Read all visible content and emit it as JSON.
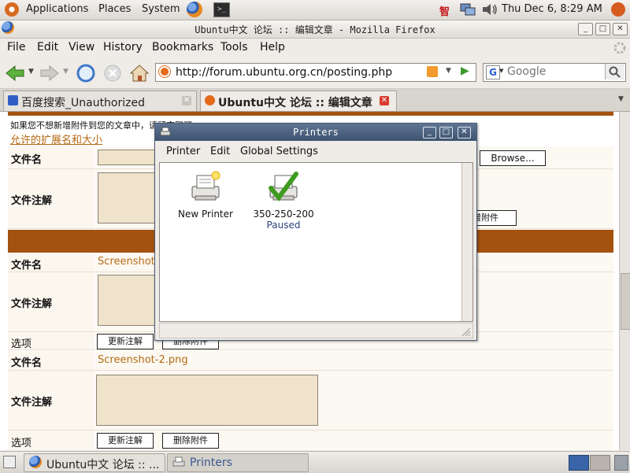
{
  "top_panel": {
    "applications": "Applications",
    "places": "Places",
    "system": "System",
    "ime": "智",
    "clock": "Thu Dec  6,  8:29 AM"
  },
  "firefox": {
    "title": "Ubuntu中文 论坛 :: 编辑文章 - Mozilla Firefox",
    "menu": [
      "File",
      "Edit",
      "View",
      "History",
      "Bookmarks",
      "Tools",
      "Help"
    ],
    "url": "http://forum.ubuntu.org.cn/posting.php",
    "search_placeholder": "Google",
    "tabs": [
      {
        "label": "百度搜索_Unauthorized"
      },
      {
        "label": "Ubuntu中文 论坛 :: 编辑文章"
      }
    ]
  },
  "page": {
    "notice": "如果您不想新增附件到您的文章中，请留空即可。",
    "extensions_link": "允许的扩展名和大小",
    "filename_label": "文件名",
    "comment_label": "文件注解",
    "options_label": "选项",
    "browse_button": "Browse...",
    "add_attachment_button": "新增附件",
    "update_comment_button": "更新注解",
    "delete_attachment_button": "删除附件",
    "attachments": [
      {
        "filename": "Screenshot-1.png"
      },
      {
        "filename": "Screenshot-2.png"
      }
    ]
  },
  "printers_dialog": {
    "title": "Printers",
    "menu": [
      "Printer",
      "Edit",
      "Global Settings"
    ],
    "items": [
      {
        "name": "New Printer",
        "state": ""
      },
      {
        "name": "350-250-200",
        "state": "Paused"
      }
    ]
  },
  "taskbar": {
    "items": [
      {
        "label": "Ubuntu中文 论坛 :: ..."
      },
      {
        "label": "Printers"
      }
    ]
  }
}
